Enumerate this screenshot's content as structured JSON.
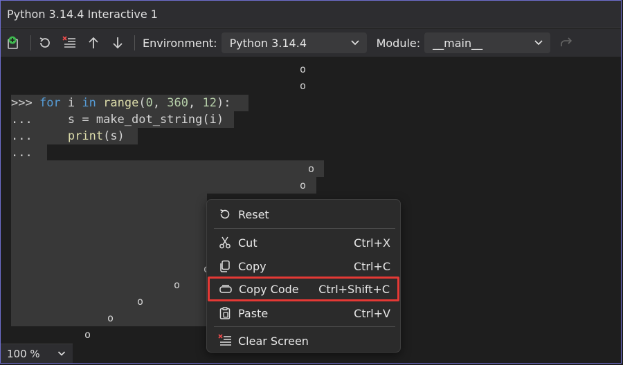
{
  "window": {
    "title": "Python 3.14.4 Interactive 1"
  },
  "toolbar": {
    "environment_label": "Environment:",
    "environment_value": "Python 3.14.4",
    "module_label": "Module:",
    "module_value": "__main__"
  },
  "console": {
    "line1": {
      "prompt": ">>> ",
      "kw1": "for",
      "sp1": " i ",
      "kw2": "in",
      "sp2": " ",
      "fn": "range",
      "p1": "(",
      "n1": "0",
      "c1": ", ",
      "n2": "360",
      "c2": ", ",
      "n3": "12",
      "p2": "):"
    },
    "line2": {
      "prompt": "...     ",
      "code": "s = make_dot_string(i)"
    },
    "line3": {
      "prompt": "...     ",
      "fn": "print",
      "rest": "(s)"
    },
    "line4": {
      "prompt": "..."
    },
    "dot": "o"
  },
  "zoom": {
    "value": "100 %"
  },
  "context_menu": {
    "items": [
      {
        "label": "Reset",
        "shortcut": ""
      },
      {
        "label": "Cut",
        "shortcut": "Ctrl+X"
      },
      {
        "label": "Copy",
        "shortcut": "Ctrl+C"
      },
      {
        "label": "Copy Code",
        "shortcut": "Ctrl+Shift+C"
      },
      {
        "label": "Paste",
        "shortcut": "Ctrl+V"
      },
      {
        "label": "Clear Screen",
        "shortcut": ""
      }
    ]
  },
  "colors": {
    "highlight": "#e53935",
    "keyword": "#569cd6",
    "function": "#dcdcaa",
    "number": "#b5cea8"
  }
}
